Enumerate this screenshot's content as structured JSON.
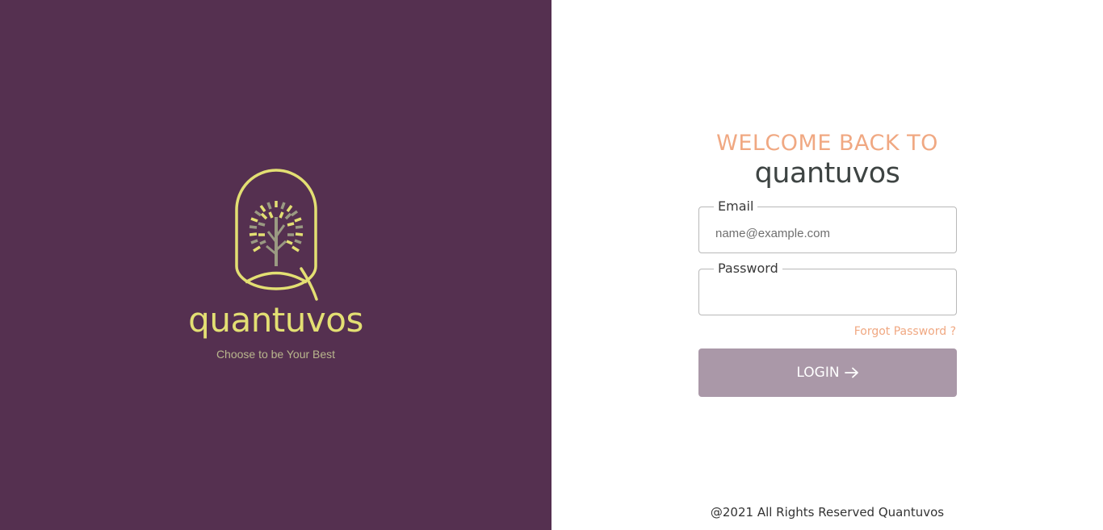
{
  "brand": {
    "name": "quantuvos",
    "tagline": "Choose to be Your Best",
    "logo_icon": "tree-in-arch-q-logo-icon",
    "panel_color": "#553050",
    "logo_color": "#e3df73"
  },
  "login": {
    "welcome_text": "WELCOME BACK TO",
    "brand_name": "quantuvos",
    "email": {
      "label": "Email",
      "placeholder": "name@example.com",
      "value": ""
    },
    "password": {
      "label": "Password",
      "placeholder": "",
      "value": ""
    },
    "forgot_link": "Forgot Password ?",
    "login_button": "LOGIN",
    "login_icon": "arrow-right-icon",
    "accent_color": "#f0a882",
    "button_color": "#aa98a8"
  },
  "footer": {
    "copyright": "@2021 All Rights Reserved Quantuvos"
  }
}
